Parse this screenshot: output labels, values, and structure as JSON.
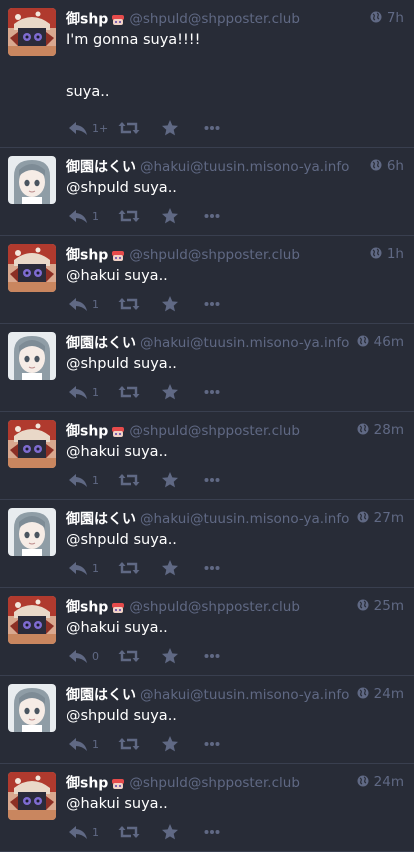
{
  "colors": {
    "background": "#282c37",
    "muted": "#606984",
    "text": "#ffffff",
    "divider": "#393f4f"
  },
  "statuses": [
    {
      "author": "shp",
      "display_name": "御shp",
      "handle": "@shpuld@shpposter.club",
      "time": "7h",
      "paragraphs": [
        "I'm gonna suya!!!!",
        "suya.."
      ],
      "replies": "1+",
      "icons": [
        "reply-icon",
        "boost-icon",
        "favourite-icon",
        "more-icon",
        "globe-icon"
      ]
    },
    {
      "author": "hakui",
      "display_name": "御園はくい",
      "handle": "@hakui@tuusin.misono-ya.info",
      "time": "6h",
      "paragraphs": [
        "@shpuld suya.."
      ],
      "replies": "1"
    },
    {
      "author": "shp",
      "display_name": "御shp",
      "handle": "@shpuld@shpposter.club",
      "time": "1h",
      "paragraphs": [
        "@hakui suya.."
      ],
      "replies": "1"
    },
    {
      "author": "hakui",
      "display_name": "御園はくい",
      "handle": "@hakui@tuusin.misono-ya.info",
      "time": "46m",
      "paragraphs": [
        "@shpuld suya.."
      ],
      "replies": "1"
    },
    {
      "author": "shp",
      "display_name": "御shp",
      "handle": "@shpuld@shpposter.club",
      "time": "28m",
      "paragraphs": [
        "@hakui suya.."
      ],
      "replies": "1"
    },
    {
      "author": "hakui",
      "display_name": "御園はくい",
      "handle": "@hakui@tuusin.misono-ya.info",
      "time": "27m",
      "paragraphs": [
        "@shpuld suya.."
      ],
      "replies": "1"
    },
    {
      "author": "shp",
      "display_name": "御shp",
      "handle": "@shpuld@shpposter.club",
      "time": "25m",
      "paragraphs": [
        "@hakui suya.."
      ],
      "replies": "0"
    },
    {
      "author": "hakui",
      "display_name": "御園はくい",
      "handle": "@hakui@tuusin.misono-ya.info",
      "time": "24m",
      "paragraphs": [
        "@shpuld suya.."
      ],
      "replies": "1"
    },
    {
      "author": "shp",
      "display_name": "御shp",
      "handle": "@shpuld@shpposter.club",
      "time": "24m",
      "paragraphs": [
        "@hakui suya.."
      ],
      "replies": "1"
    }
  ]
}
